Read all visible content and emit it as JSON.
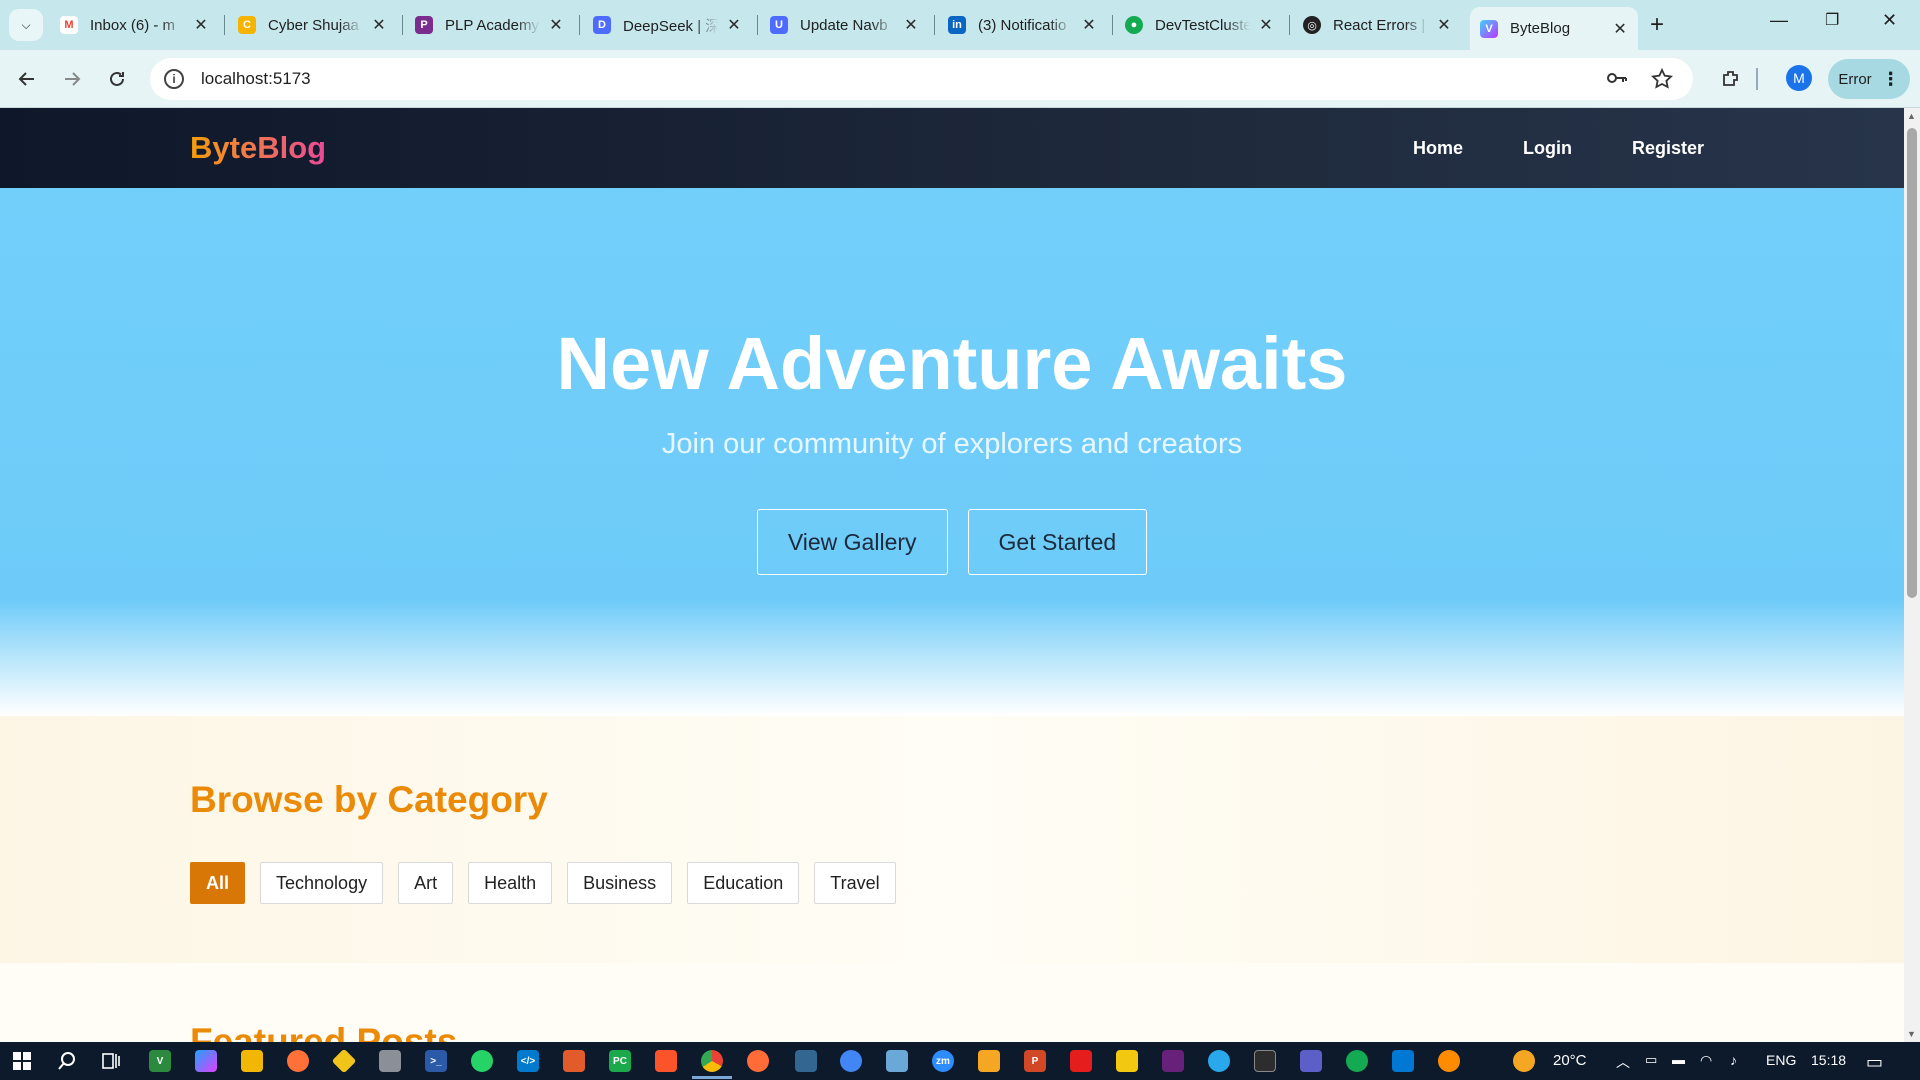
{
  "browser": {
    "tabs": [
      {
        "label": "Inbox (6) - m",
        "color": "#ea4335",
        "glyph": "M"
      },
      {
        "label": "Cyber Shujaa",
        "color": "#f4b400",
        "glyph": "C"
      },
      {
        "label": "PLP Academy",
        "color": "#7b2c8f",
        "glyph": "P"
      },
      {
        "label": "DeepSeek | 深",
        "color": "#4d6bfe",
        "glyph": "D"
      },
      {
        "label": "Update Navb",
        "color": "#4d6bfe",
        "glyph": "U"
      },
      {
        "label": "(3) Notificatio",
        "color": "#0a66c2",
        "glyph": "in"
      },
      {
        "label": "DevTestCluste",
        "color": "#13aa52",
        "glyph": "●"
      },
      {
        "label": "React Errors |",
        "color": "#222222",
        "glyph": "◎"
      },
      {
        "label": "ByteBlog",
        "color": "#a259ff",
        "glyph": "V"
      }
    ],
    "url": "localhost:5173",
    "profile_initial": "M",
    "error_label": "Error"
  },
  "site": {
    "brand": "ByteBlog",
    "nav": {
      "home": "Home",
      "login": "Login",
      "register": "Register"
    },
    "hero": {
      "title": "New Adventure Awaits",
      "subtitle": "Join our community of explorers and creators",
      "view_gallery": "View Gallery",
      "get_started": "Get Started"
    },
    "categories": {
      "heading": "Browse by Category",
      "items": [
        "All",
        "Technology",
        "Art",
        "Health",
        "Business",
        "Education",
        "Travel"
      ],
      "active": "All"
    },
    "featured": {
      "heading": "Featured Posts"
    }
  },
  "taskbar": {
    "temperature": "20°C",
    "language": "ENG",
    "time": "15:18"
  },
  "colors": {
    "accent": "#d97706",
    "heading": "#ea8a07",
    "navbar": "#0f172a",
    "hero": "#72cffa"
  }
}
